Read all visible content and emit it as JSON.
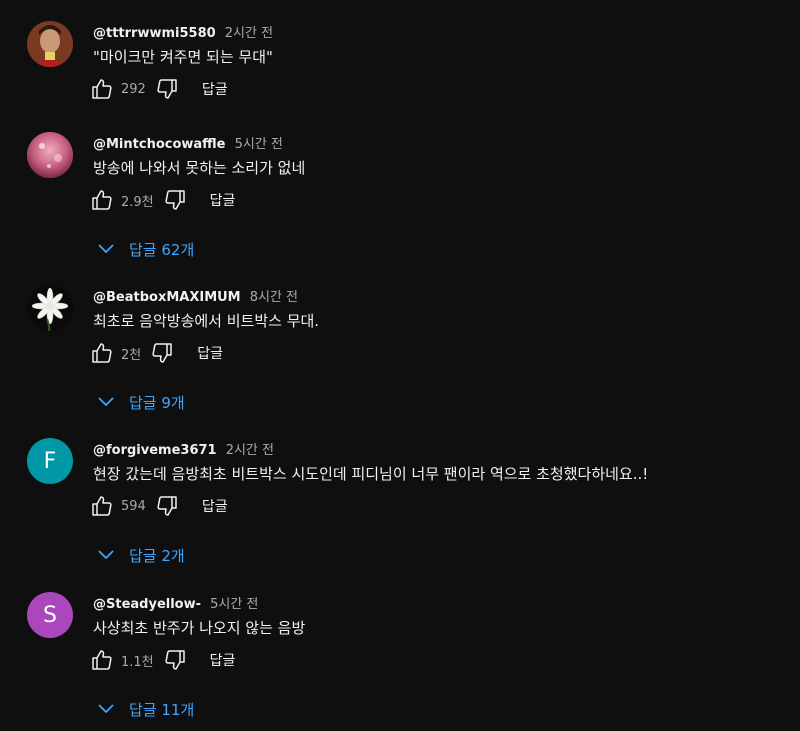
{
  "comments": [
    {
      "author": "@tttrrwwmi5580",
      "time": "2시간 전",
      "text": "\"마이크만 켜주면 되는 무대\"",
      "likes": "292",
      "reply_label": "답글",
      "replies": null
    },
    {
      "author": "@Mintchocowaffle",
      "time": "5시간 전",
      "text": "방송에 나와서 못하는 소리가 없네",
      "likes": "2.9천",
      "reply_label": "답글",
      "replies": "답글 62개"
    },
    {
      "author": "@BeatboxMAXIMUM",
      "time": "8시간 전",
      "text": "최초로 음악방송에서 비트박스 무대.",
      "likes": "2천",
      "reply_label": "답글",
      "replies": "답글 9개"
    },
    {
      "author": "@forgiveme3671",
      "time": "2시간 전",
      "text": "현장 갔는데 음방최초 비트박스 시도인데 피디님이 너무 팬이라 역으로 초청했다하네요..!",
      "likes": "594",
      "reply_label": "답글",
      "replies": "답글 2개",
      "avatar_letter": "F",
      "avatar_color": "#0097a7"
    },
    {
      "author": "@Steadyellow-",
      "time": "5시간 전",
      "text": "사상최초 반주가 나오지 않는 음방",
      "likes": "1.1천",
      "reply_label": "답글",
      "replies": "답글 11개",
      "avatar_letter": "S",
      "avatar_color": "#ab47bc"
    }
  ],
  "icons": {
    "like": "thumb-up-icon",
    "dislike": "thumb-down-icon",
    "expand": "chevron-down-icon"
  },
  "colors": {
    "background": "#0f0f0f",
    "link": "#3ea6ff",
    "secondary_text": "#aaaaaa"
  }
}
